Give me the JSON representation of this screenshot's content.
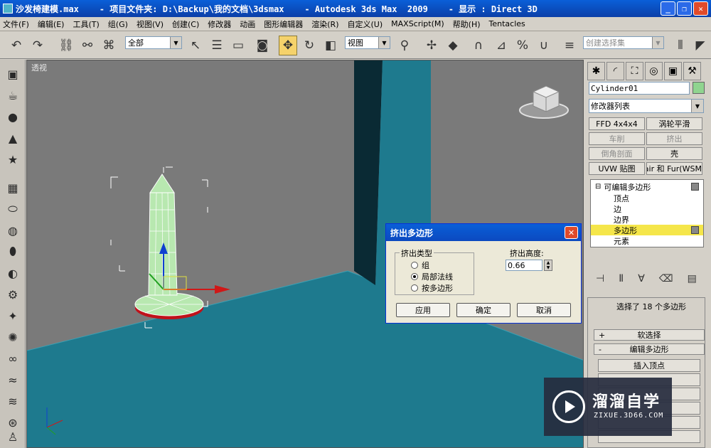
{
  "titlebar": {
    "text": "沙发椅建模.max    - 项目文件夹: D:\\Backup\\我的文档\\3dsmax    - Autodesk 3ds Max  2009    - 显示 : Direct 3D",
    "minimize": "_",
    "maximize": "❐",
    "close": "✕"
  },
  "menu": [
    "文件(F)",
    "编辑(E)",
    "工具(T)",
    "组(G)",
    "视图(V)",
    "创建(C)",
    "修改器",
    "动画",
    "图形编辑器",
    "渲染(R)",
    "自定义(U)",
    "MAXScript(M)",
    "帮助(H)",
    "Tentacles"
  ],
  "toolbar": {
    "selection_filter": "全部",
    "reference_coord": "视图",
    "named_selection_placeholder": "创建选择集"
  },
  "viewport": {
    "label": "透视"
  },
  "command_panel": {
    "object_name": "Cylinder01",
    "modifier_list": "修改器列表",
    "modifier_buttons": [
      {
        "label": "FFD 4x4x4",
        "enabled": true
      },
      {
        "label": "涡轮平滑",
        "enabled": true
      },
      {
        "label": "车削",
        "enabled": false
      },
      {
        "label": "挤出",
        "enabled": false
      },
      {
        "label": "倒角剖面",
        "enabled": false
      },
      {
        "label": "壳",
        "enabled": true
      },
      {
        "label": "UVW 贴图",
        "enabled": true
      },
      {
        "label": "air 和 Fur(WSM)",
        "enabled": true
      }
    ],
    "stack": {
      "root": "可编辑多边形",
      "sub_objects": [
        "顶点",
        "边",
        "边界",
        "多边形",
        "元素"
      ],
      "selected": "多边形"
    },
    "selection_info": "选择了 18 个多边形",
    "rollouts": {
      "soft_selection": "软选择",
      "edit_polygons": "编辑多边形",
      "insert_vertex": "插入顶点"
    }
  },
  "dialog": {
    "title": "挤出多边形",
    "group_label": "挤出类型",
    "options": [
      "组",
      "局部法线",
      "按多边形"
    ],
    "selected_option": "局部法线",
    "height_label": "挤出高度:",
    "height_value": "0.66",
    "buttons": {
      "apply": "应用",
      "ok": "确定",
      "cancel": "取消"
    }
  },
  "watermark": {
    "title": "溜溜自学",
    "url": "ZIXUE.3D66.COM"
  },
  "colors": {
    "floor": "#1e7a8e",
    "wall": "#7a7a7a",
    "selection_highlight": "#f5e64a",
    "title_blue": "#0a5fd8"
  }
}
